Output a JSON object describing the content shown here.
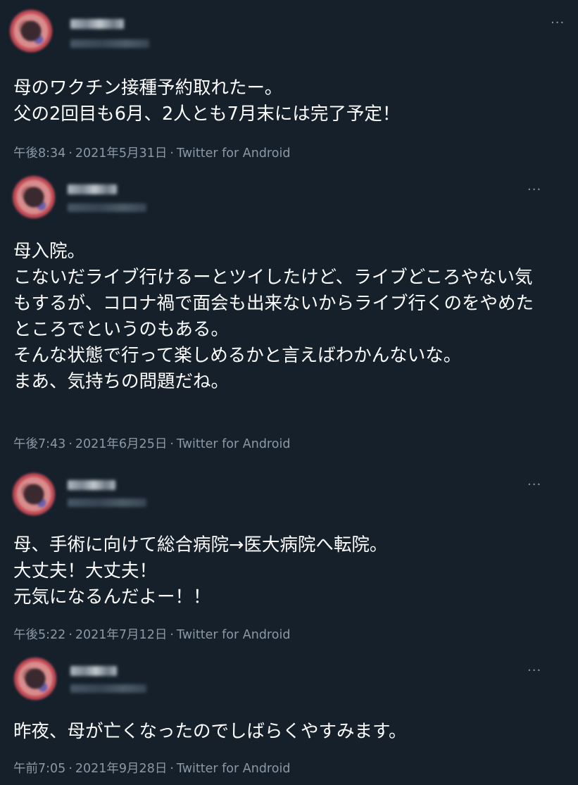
{
  "more_label": "···",
  "colors": {
    "background": "#15202b",
    "text_primary": "#ffffff",
    "text_secondary": "#8b98a5"
  },
  "tweets": [
    {
      "text": "母のワクチン接種予約取れたー。\n父の2回目も6月、2人とも7月末には完了予定！",
      "time": "午後8:34",
      "date": "2021年5月31日",
      "source": "Twitter for Android"
    },
    {
      "text": "母入院。\nこないだライブ行けるーとツイしたけど、ライブどころやない気もするが、コロナ禍で面会も出来ないからライブ行くのをやめたところでというのもある。\nそんな状態で行って楽しめるかと言えばわかんないな。\nまあ、気持ちの問題だね。",
      "time": "午後7:43",
      "date": "2021年6月25日",
      "source": "Twitter for Android"
    },
    {
      "text": "母、手術に向けて総合病院→医大病院へ転院。\n大丈夫！大丈夫！\n元気になるんだよー！！",
      "time": "午後5:22",
      "date": "2021年7月12日",
      "source": "Twitter for Android"
    },
    {
      "text": "昨夜、母が亡くなったのでしばらくやすみます。",
      "time": "午前7:05",
      "date": "2021年9月28日",
      "source": "Twitter for Android"
    }
  ]
}
